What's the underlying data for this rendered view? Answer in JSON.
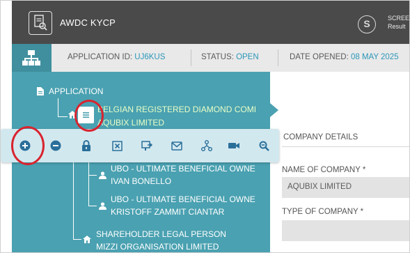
{
  "header": {
    "app_title": "AWDC KYCP",
    "screen_text_line1": "SCREE",
    "screen_text_line2": "Result",
    "screen_icon_glyph": "S"
  },
  "infobar": {
    "application_id_label": "APPLICATION ID: ",
    "application_id_value": "UJ6KUS",
    "status_label": "STATUS: ",
    "status_value": "OPEN",
    "date_opened_label": "DATE OPENED: ",
    "date_opened_value": "08 MAY 2025"
  },
  "tree": {
    "root_label": "APPLICATION",
    "selected_line1": "BELGIAN REGISTERED DIAMOND COMI",
    "selected_line2": "AQUBIX LIMITED",
    "children": [
      {
        "title": "UBO - ULTIMATE BENEFICIAL OWNE",
        "name": "IVAN BONELLO"
      },
      {
        "title": "UBO - ULTIMATE BENEFICIAL OWNE",
        "name": "KRISTOFF ZAMMIT CIANTAR"
      }
    ],
    "shareholder_title": "SHAREHOLDER LEGAL PERSON",
    "shareholder_name": "MIZZI ORGANISATION LIMITED"
  },
  "toolbar": {
    "buttons": [
      "add-icon",
      "remove-icon",
      "lock-icon",
      "close-box-icon",
      "reassign-icon",
      "email-icon",
      "hierarchy-icon",
      "video-icon",
      "search-icon"
    ]
  },
  "content": {
    "company_details_heading": "COMPANY DETAILS",
    "name_of_company_label": "NAME OF COMPANY *",
    "name_of_company_value": "AQUBIX LIMITED",
    "type_of_company_label": "TYPE OF COMPANY *",
    "type_of_company_value": ""
  },
  "colors": {
    "header_bg": "#4a4a4a",
    "panel_teal": "#4aa1b1",
    "toolbar_bg": "#d2e8ef",
    "toolbar_icon": "#2a6f9a",
    "accent_link": "#2c96b8",
    "annotation_red": "#d9232e"
  }
}
